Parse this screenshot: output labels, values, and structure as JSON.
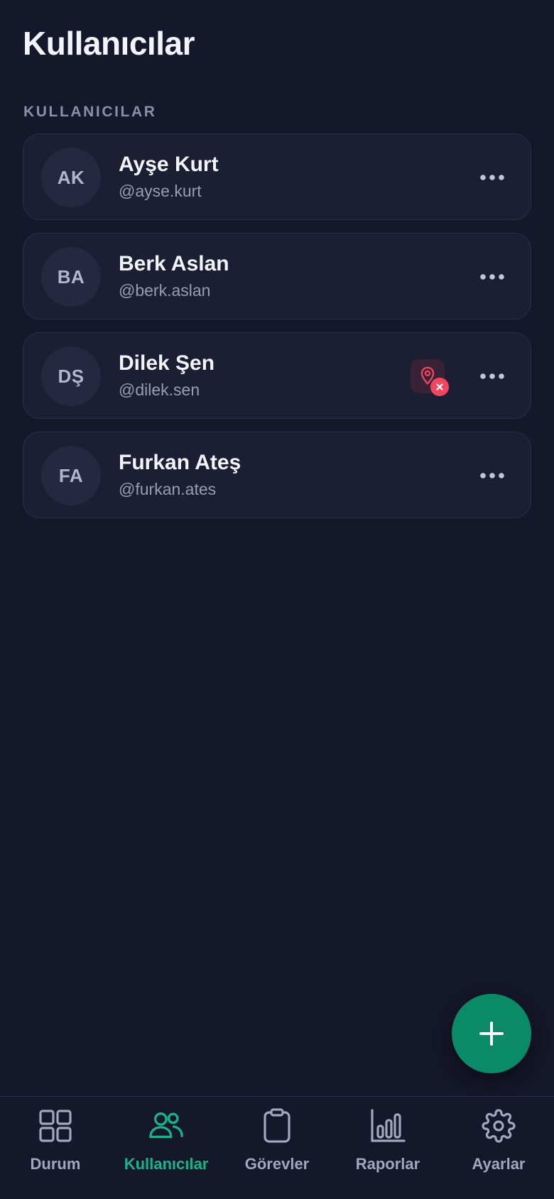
{
  "page": {
    "title": "Kullanıcılar",
    "section_label": "KULLANICILAR"
  },
  "users": [
    {
      "initials": "AK",
      "name": "Ayşe Kurt",
      "handle": "@ayse.kurt",
      "location_off": false
    },
    {
      "initials": "BA",
      "name": "Berk Aslan",
      "handle": "@berk.aslan",
      "location_off": false
    },
    {
      "initials": "DŞ",
      "name": "Dilek Şen",
      "handle": "@dilek.sen",
      "location_off": true
    },
    {
      "initials": "FA",
      "name": "Furkan Ateş",
      "handle": "@furkan.ates",
      "location_off": false
    }
  ],
  "icons": {
    "more": "more-horizontal-icon",
    "location_off": "location-pin-icon",
    "error_badge": "close-icon",
    "fab": "plus-icon"
  },
  "bottom_nav": [
    {
      "label": "Durum",
      "icon": "grid-icon",
      "active": false
    },
    {
      "label": "Kullanıcılar",
      "icon": "users-icon",
      "active": true
    },
    {
      "label": "Görevler",
      "icon": "clipboard-icon",
      "active": false
    },
    {
      "label": "Raporlar",
      "icon": "bar-chart-icon",
      "active": false
    },
    {
      "label": "Ayarlar",
      "icon": "gear-icon",
      "active": false
    }
  ],
  "colors": {
    "background": "#15172a",
    "card": "#1c1e33",
    "accent": "#18b38b",
    "fab": "#0b8a67",
    "danger": "#f0465f",
    "muted_text": "#9a9db2"
  }
}
